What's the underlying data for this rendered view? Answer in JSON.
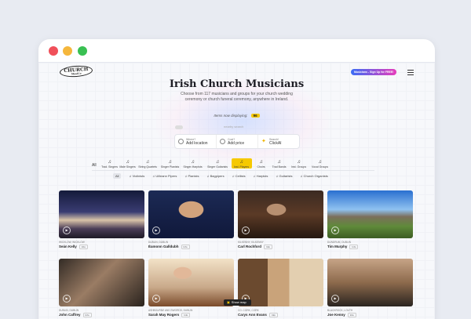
{
  "header": {
    "logo_text": "CHURCH",
    "logo_sub": "MusiCo",
    "signup_label": "Musicians - Sign Up for FREE!"
  },
  "hero": {
    "title": "Irish Church Musicians",
    "subtitle": "Choose from 117 musicians and groups for your church wedding ceremony or church funeral ceremony, anywhere in Ireland.",
    "displaying_label": "Items now displaying:",
    "displaying_count": "96",
    "nearby_label": "nearby search"
  },
  "search": {
    "where_label": "Where?",
    "where_placeholder": "Add location",
    "cost_label": "Cost?",
    "cost_placeholder": "Add price",
    "search_label": "Search!",
    "search_value": "ClickAI"
  },
  "categories": {
    "all_label": "All",
    "items": [
      "Trad. Singers",
      "Male Singers",
      "String Quartets",
      "Singer Pianists",
      "Singer-Harpists",
      "Singer Guitarists",
      "Inst. Players",
      "Choirs",
      "Trad Bands",
      "Inst. Groups",
      "Vocal Groups"
    ],
    "active": "Inst. Players"
  },
  "subcategories": {
    "items": [
      "All",
      "Violinists",
      "Uilleann Pipers",
      "Pianists",
      "Bagpipers",
      "Cellists",
      "Harpists",
      "Guitarists",
      "Church Organists"
    ],
    "active": "All"
  },
  "cards": [
    {
      "location": "Wicklow, Wicklow",
      "name": "Seán Kelly"
    },
    {
      "location": "Dublin, Dublin",
      "name": "Éamonn Galldubh"
    },
    {
      "location": "Kilkenny, Kilkenny",
      "name": "Carl Rochford"
    },
    {
      "location": "Dundrum, Dublin",
      "name": "Tim Murphy"
    },
    {
      "location": "Dublin, Dublin",
      "name": "John Caffrey"
    },
    {
      "location": "Ashbourne and Swords, Dublin",
      "name": "Sarah May Rogers"
    },
    {
      "location": "Co. Cork, Cork",
      "name": "Carys Ann Evans"
    },
    {
      "location": "Blackrock, Louth",
      "name": "Joe Kenny"
    }
  ],
  "info_label": "Info",
  "show_map_label": "Show map"
}
